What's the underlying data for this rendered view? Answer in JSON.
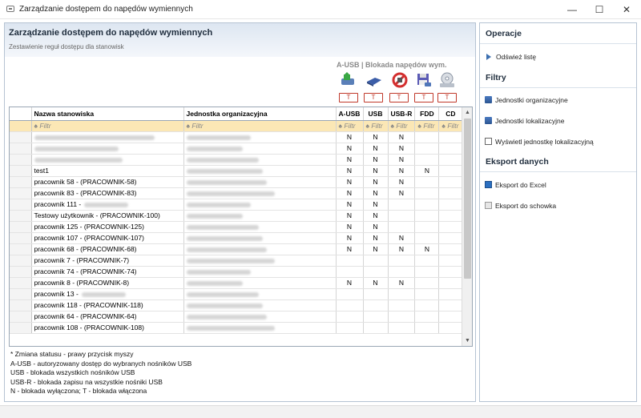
{
  "window": {
    "title": "Zarządzanie dostępem do napędów wymiennych",
    "minimize_glyph": "—",
    "maximize_glyph": "☐",
    "close_glyph": "✕"
  },
  "panel": {
    "title": "Zarządzanie dostępem do napędów wymiennych",
    "subtitle": "Zestawienie reguł dostępu dla stanowisk",
    "block_caption": "A-USB | Blokada napędów wym."
  },
  "devices": [
    {
      "icon": "authorized-usb-icon",
      "toggle_label": "T"
    },
    {
      "icon": "usb-drive-icon",
      "toggle_label": "T"
    },
    {
      "icon": "usb-readonly-icon",
      "toggle_label": "T"
    },
    {
      "icon": "floppy-drive-icon",
      "toggle_label": "T"
    },
    {
      "icon": "cd-drive-icon",
      "toggle_label": "T"
    }
  ],
  "grid": {
    "columns": [
      "Nazwa stanowiska",
      "Jednostka organizacyjna",
      "A-USB",
      "USB",
      "USB-R",
      "FDD",
      "CD"
    ],
    "filter_text": "Filtr",
    "filter_glyph": "♠",
    "rows": [
      {
        "name": "",
        "name_blur": true,
        "aus": "N",
        "usb": "N",
        "usbr": "N",
        "fdd": "",
        "cd": ""
      },
      {
        "name": "",
        "name_blur": true,
        "aus": "N",
        "usb": "N",
        "usbr": "N",
        "fdd": "",
        "cd": ""
      },
      {
        "name": "",
        "name_blur": true,
        "aus": "N",
        "usb": "N",
        "usbr": "N",
        "fdd": "",
        "cd": ""
      },
      {
        "name": "test1",
        "name_blur": false,
        "aus": "N",
        "usb": "N",
        "usbr": "N",
        "fdd": "N",
        "cd": ""
      },
      {
        "name": "pracownik 58 - (PRACOWNIK-58)",
        "name_blur": false,
        "aus": "N",
        "usb": "N",
        "usbr": "N",
        "fdd": "",
        "cd": ""
      },
      {
        "name": "pracownik 83 - (PRACOWNIK-83)",
        "name_blur": false,
        "aus": "N",
        "usb": "N",
        "usbr": "N",
        "fdd": "",
        "cd": ""
      },
      {
        "name": "pracownik 111 -",
        "name_blur": true,
        "aus": "N",
        "usb": "N",
        "usbr": "",
        "fdd": "",
        "cd": ""
      },
      {
        "name": "Testowy użytkownik - (PRACOWNIK-100)",
        "name_blur": false,
        "aus": "N",
        "usb": "N",
        "usbr": "",
        "fdd": "",
        "cd": ""
      },
      {
        "name": "pracownik 125 - (PRACOWNIK-125)",
        "name_blur": false,
        "aus": "N",
        "usb": "N",
        "usbr": "",
        "fdd": "",
        "cd": ""
      },
      {
        "name": "pracownik 107 - (PRACOWNIK-107)",
        "name_blur": false,
        "aus": "N",
        "usb": "N",
        "usbr": "N",
        "fdd": "",
        "cd": ""
      },
      {
        "name": "pracownik 68 - (PRACOWNIK-68)",
        "name_blur": false,
        "aus": "N",
        "usb": "N",
        "usbr": "N",
        "fdd": "N",
        "cd": ""
      },
      {
        "name": "pracownik 7 - (PRACOWNIK-7)",
        "name_blur": false,
        "aus": "",
        "usb": "",
        "usbr": "",
        "fdd": "",
        "cd": ""
      },
      {
        "name": "pracownik 74 - (PRACOWNIK-74)",
        "name_blur": false,
        "aus": "",
        "usb": "",
        "usbr": "",
        "fdd": "",
        "cd": ""
      },
      {
        "name": "pracownik 8 - (PRACOWNIK-8)",
        "name_blur": false,
        "aus": "N",
        "usb": "N",
        "usbr": "N",
        "fdd": "",
        "cd": ""
      },
      {
        "name": "pracownik 13 -",
        "name_blur": true,
        "aus": "",
        "usb": "",
        "usbr": "",
        "fdd": "",
        "cd": ""
      },
      {
        "name": "pracownik 118 - (PRACOWNIK-118)",
        "name_blur": false,
        "aus": "",
        "usb": "",
        "usbr": "",
        "fdd": "",
        "cd": ""
      },
      {
        "name": "pracownik 64 - (PRACOWNIK-64)",
        "name_blur": false,
        "aus": "",
        "usb": "",
        "usbr": "",
        "fdd": "",
        "cd": ""
      },
      {
        "name": "pracownik 108 - (PRACOWNIK-108)",
        "name_blur": false,
        "aus": "",
        "usb": "",
        "usbr": "",
        "fdd": "",
        "cd": ""
      }
    ]
  },
  "legend": [
    "* Zmiana statusu - prawy przycisk myszy",
    "A-USB - autoryzowany dostęp do wybranych nośników USB",
    "USB - blokada wszystkich nośników USB",
    "USB-R - blokada zapisu na wszystkie nośniki USB",
    "N - blokada wyłączona; T - blokada włączona"
  ],
  "side": {
    "operations_title": "Operacje",
    "refresh_label": "Odśwież listę",
    "filters_title": "Filtry",
    "org_units_label": "Jednostki organizacyjne",
    "loc_units_label": "Jednostki lokalizacyjne",
    "show_loc_label": "Wyświetl jednostkę lokalizacyjną",
    "export_title": "Eksport danych",
    "export_excel_label": "Eksport do Excel",
    "export_clip_label": "Eksport do schowka"
  },
  "colors": {
    "filter_row": "#fbe7b5",
    "toggle_red": "#c0392b",
    "header_blue": "#dde6f1"
  }
}
